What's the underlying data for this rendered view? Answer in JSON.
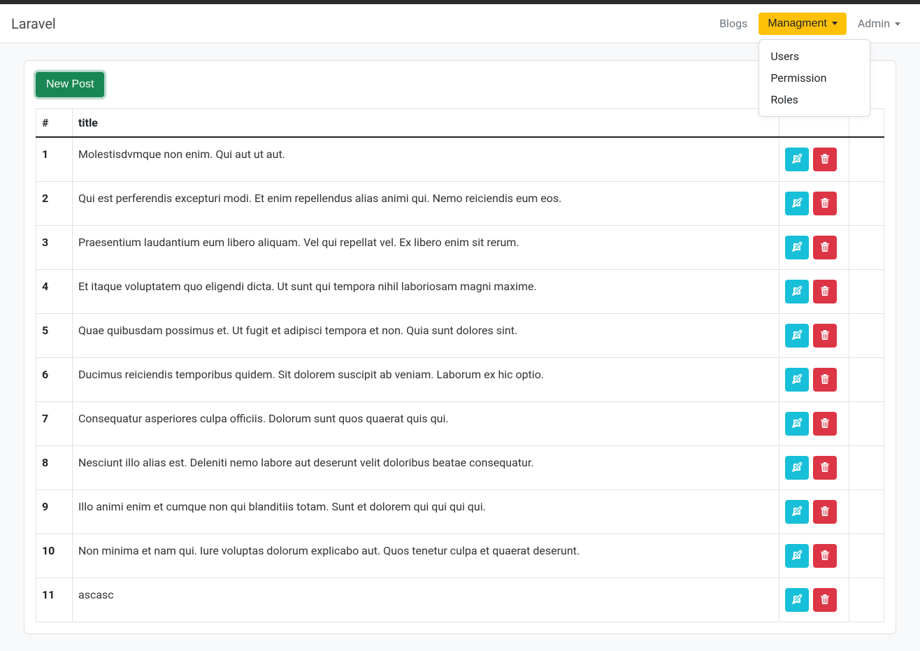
{
  "navbar": {
    "brand": "Laravel",
    "links": {
      "blogs": "Blogs",
      "management": "Managment",
      "admin": "Admin"
    },
    "management_menu": [
      {
        "label": "Users"
      },
      {
        "label": "Permission"
      },
      {
        "label": "Roles"
      }
    ]
  },
  "actions": {
    "new_post": "New Post"
  },
  "table": {
    "headers": {
      "index": "#",
      "title": "title"
    },
    "rows": [
      {
        "num": "1",
        "title": "Molestisdvmque non enim. Qui aut ut aut."
      },
      {
        "num": "2",
        "title": "Qui est perferendis excepturi modi. Et enim repellendus alias animi qui. Nemo reiciendis eum eos."
      },
      {
        "num": "3",
        "title": "Praesentium laudantium eum libero aliquam. Vel qui repellat vel. Ex libero enim sit rerum."
      },
      {
        "num": "4",
        "title": "Et itaque voluptatem quo eligendi dicta. Ut sunt qui tempora nihil laboriosam magni maxime."
      },
      {
        "num": "5",
        "title": "Quae quibusdam possimus et. Ut fugit et adipisci tempora et non. Quia sunt dolores sint."
      },
      {
        "num": "6",
        "title": "Ducimus reiciendis temporibus quidem. Sit dolorem suscipit ab veniam. Laborum ex hic optio."
      },
      {
        "num": "7",
        "title": "Consequatur asperiores culpa officiis. Dolorum sunt quos quaerat quis qui."
      },
      {
        "num": "8",
        "title": "Nesciunt illo alias est. Deleniti nemo labore aut deserunt velit doloribus beatae consequatur."
      },
      {
        "num": "9",
        "title": "Illo animi enim et cumque non qui blanditiis totam. Sunt et dolorem qui qui qui qui."
      },
      {
        "num": "10",
        "title": "Non minima et nam qui. Iure voluptas dolorum explicabo aut. Quos tenetur culpa et quaerat deserunt."
      },
      {
        "num": "11",
        "title": "ascasc"
      }
    ]
  }
}
